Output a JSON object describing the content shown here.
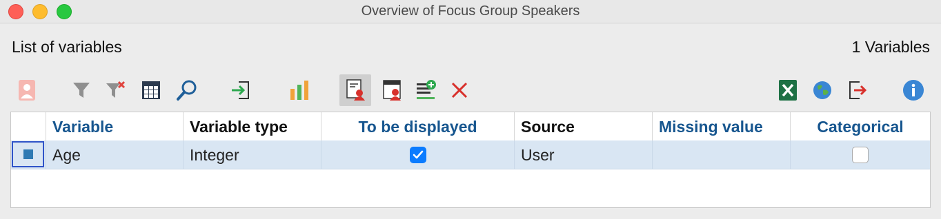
{
  "window": {
    "title": "Overview of Focus Group Speakers"
  },
  "header": {
    "left_label": "List of variables",
    "right_label": "1 Variables"
  },
  "toolbar": {
    "buttons": [
      {
        "name": "speaker-icon",
        "state": "disabled"
      },
      {
        "name": "filter-icon",
        "state": "disabled"
      },
      {
        "name": "clear-filter-icon",
        "state": "disabled"
      },
      {
        "name": "columns-icon",
        "state": "enabled"
      },
      {
        "name": "search-icon",
        "state": "enabled"
      },
      {
        "name": "import-icon",
        "state": "enabled"
      },
      {
        "name": "bar-chart-icon",
        "state": "enabled"
      },
      {
        "name": "list-of-variables-icon",
        "state": "active"
      },
      {
        "name": "data-editor-icon",
        "state": "enabled"
      },
      {
        "name": "new-variable-icon",
        "state": "enabled"
      },
      {
        "name": "delete-icon",
        "state": "enabled"
      },
      {
        "name": "excel-icon",
        "state": "enabled"
      },
      {
        "name": "globe-icon",
        "state": "enabled"
      },
      {
        "name": "export-icon",
        "state": "enabled"
      },
      {
        "name": "info-icon",
        "state": "enabled"
      }
    ]
  },
  "table": {
    "columns": [
      "",
      "Variable",
      "Variable type",
      "To be displayed",
      "Source",
      "Missing value",
      "Categorical"
    ],
    "rows": [
      {
        "variable": "Age",
        "variable_type": "Integer",
        "to_be_displayed": true,
        "source": "User",
        "missing_value": "",
        "categorical": false
      }
    ]
  },
  "colors": {
    "header_blue": "#17568f",
    "row_highlight": "#d9e6f3",
    "checkbox_blue": "#0b7cff"
  }
}
